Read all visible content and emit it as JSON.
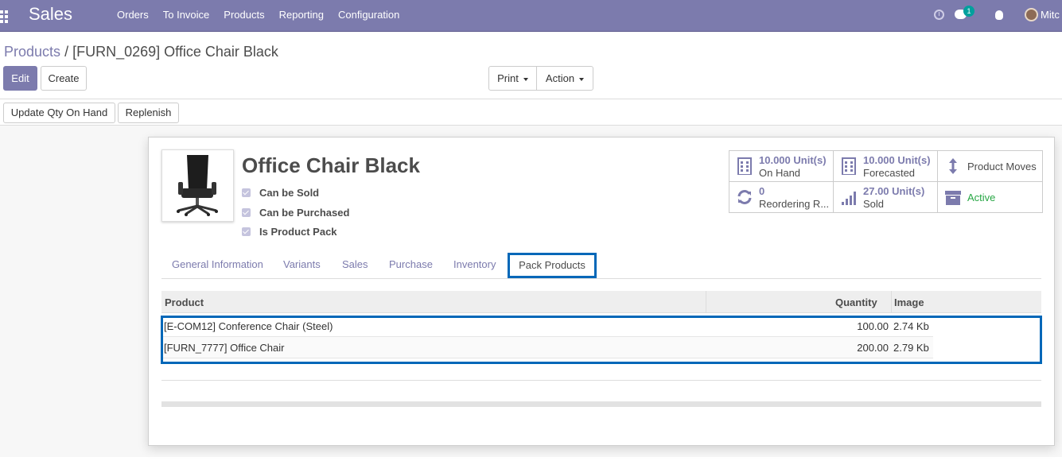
{
  "navbar": {
    "brand": "Sales",
    "menu": [
      "Orders",
      "To Invoice",
      "Products",
      "Reporting",
      "Configuration"
    ],
    "chat_badge": "1",
    "user": "Mitc"
  },
  "breadcrumb": {
    "parent": "Products",
    "separator": "/",
    "current": "[FURN_0269] Office Chair Black"
  },
  "buttons": {
    "edit": "Edit",
    "create": "Create",
    "print": "Print",
    "action": "Action",
    "update_qty": "Update Qty On Hand",
    "replenish": "Replenish"
  },
  "product": {
    "name": "Office Chair Black",
    "checks": [
      "Can be Sold",
      "Can be Purchased",
      "Is Product Pack"
    ]
  },
  "smart_buttons": {
    "on_hand": {
      "value": "10.000 Unit(s)",
      "label": "On Hand"
    },
    "forecasted": {
      "value": "10.000 Unit(s)",
      "label": "Forecasted"
    },
    "moves": {
      "label": "Product Moves"
    },
    "reordering": {
      "value": "0",
      "label": "Reordering R..."
    },
    "sold": {
      "value": "27.00 Unit(s)",
      "label": "Sold"
    },
    "active": {
      "label": "Active"
    }
  },
  "colors": {
    "primary": "#7c7bad",
    "highlight": "#0067b8",
    "active_green": "#28a745"
  },
  "tabs": [
    "General Information",
    "Variants",
    "Sales",
    "Purchase",
    "Inventory",
    "Pack Products"
  ],
  "table": {
    "headers": [
      "Product",
      "Quantity",
      "Image"
    ],
    "rows": [
      {
        "product": "[E-COM12] Conference Chair (Steel)",
        "quantity": "100.00",
        "image": "2.74 Kb"
      },
      {
        "product": "[FURN_7777] Office Chair",
        "quantity": "200.00",
        "image": "2.79 Kb"
      }
    ]
  }
}
